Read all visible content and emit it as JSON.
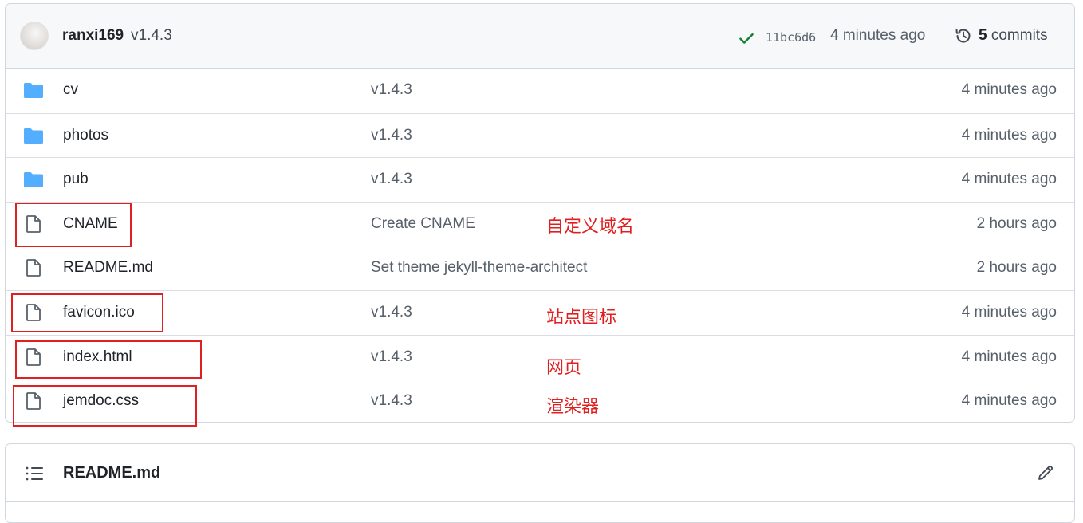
{
  "commit": {
    "author": "ranxi169",
    "message": "v1.4.3",
    "status_icon": "check-icon",
    "sha": "11bc6d6",
    "time": "4 minutes ago",
    "commits_count": "5",
    "commits_label": "commits"
  },
  "files": [
    {
      "name": "cv",
      "type": "folder",
      "message": "v1.4.3",
      "time": "4 minutes ago"
    },
    {
      "name": "photos",
      "type": "folder",
      "message": "v1.4.3",
      "time": "4 minutes ago"
    },
    {
      "name": "pub",
      "type": "folder",
      "message": "v1.4.3",
      "time": "4 minutes ago"
    },
    {
      "name": "CNAME",
      "type": "file",
      "message": "Create CNAME",
      "time": "2 hours ago"
    },
    {
      "name": "README.md",
      "type": "file",
      "message": "Set theme jekyll-theme-architect",
      "time": "2 hours ago"
    },
    {
      "name": "favicon.ico",
      "type": "file",
      "message": "v1.4.3",
      "time": "4 minutes ago"
    },
    {
      "name": "index.html",
      "type": "file",
      "message": "v1.4.3",
      "time": "4 minutes ago"
    },
    {
      "name": "jemdoc.css",
      "type": "file",
      "message": "v1.4.3",
      "time": "4 minutes ago"
    }
  ],
  "annotations": {
    "cname": "自定义域名",
    "favicon": "站点图标",
    "index": "网页",
    "css": "渲染器"
  },
  "readme": {
    "title": "README.md"
  },
  "colors": {
    "folder": "#54aeff",
    "check": "#1a7f37",
    "annotation": "#e02020"
  }
}
